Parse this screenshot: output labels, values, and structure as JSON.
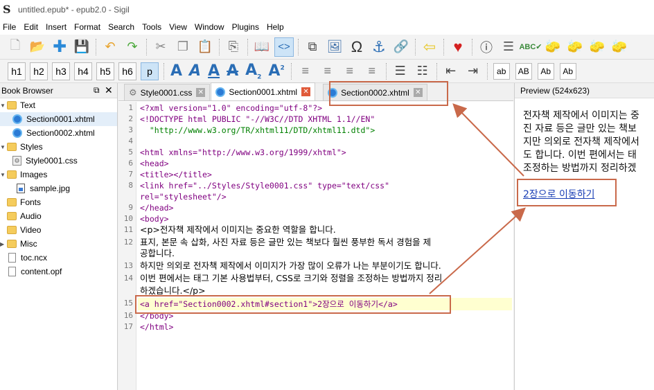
{
  "window": {
    "title": "untitled.epub* - epub2.0 - Sigil"
  },
  "menu": [
    "File",
    "Edit",
    "Insert",
    "Format",
    "Search",
    "Tools",
    "View",
    "Window",
    "Plugins",
    "Help"
  ],
  "toolbar2": {
    "headings": [
      "h1",
      "h2",
      "h3",
      "h4",
      "h5",
      "h6",
      "p"
    ],
    "case_buttons": [
      "ab",
      "AB",
      "Ab",
      "Ab"
    ]
  },
  "book_browser": {
    "title": "Book Browser",
    "items": [
      {
        "label": "Text",
        "type": "folder"
      },
      {
        "label": "Section0001.xhtml",
        "type": "xhtml"
      },
      {
        "label": "Section0002.xhtml",
        "type": "xhtml"
      },
      {
        "label": "Styles",
        "type": "folder"
      },
      {
        "label": "Style0001.css",
        "type": "css"
      },
      {
        "label": "Images",
        "type": "folder"
      },
      {
        "label": "sample.jpg",
        "type": "image"
      },
      {
        "label": "Fonts",
        "type": "folder"
      },
      {
        "label": "Audio",
        "type": "folder"
      },
      {
        "label": "Video",
        "type": "folder"
      },
      {
        "label": "Misc",
        "type": "folder"
      },
      {
        "label": "toc.ncx",
        "type": "file"
      },
      {
        "label": "content.opf",
        "type": "file"
      }
    ]
  },
  "tabs": [
    {
      "label": "Style0001.css"
    },
    {
      "label": "Section0001.xhtml"
    },
    {
      "label": "Section0002.xhtml"
    }
  ],
  "code": {
    "line_numbers": [
      "1",
      "2",
      "3",
      "4",
      "5",
      "6",
      "7",
      "8",
      "9",
      "10",
      "11",
      "12",
      "13",
      "14",
      "15",
      "16",
      "17"
    ],
    "lines": {
      "l1": "<?xml version=\"1.0\" encoding=\"utf-8\"?>",
      "l2": "<!DOCTYPE html PUBLIC \"-//W3C//DTD XHTML 1.1//EN\"",
      "l2b": "  \"http://www.w3.org/TR/xhtml11/DTD/xhtml11.dtd\">",
      "l4": "<html xmlns=\"http://www.w3.org/1999/xhtml\">",
      "l5": "<head>",
      "l6": "<title></title>",
      "l7": "<link href=\"../Styles/Style0001.css\" type=\"text/css\"",
      "l7b": "rel=\"stylesheet\"/>",
      "l8": "</head>",
      "l9": "<body>",
      "l10": "<p>전자책 제작에서 이미지는 중요한 역할을 합니다.",
      "l11": "표지, 본문 속 삽화, 사진 자료 등은 글만 있는 책보다 훨씬 풍부한 독서 경험을 제",
      "l11b": "공합니다.",
      "l12": "하지만 의외로 전자책 제작에서 이미지가 가장 많이 오류가 나는 부분이기도 합니다.",
      "l13": "이번 편에서는 태그 기본 사용법부터, CSS로 크기와 정렬을 조정하는 방법까지 정리",
      "l13b": "하겠습니다.</p>",
      "l15": "<a href=\"Section0002.xhtml#section1\">2장으로 이동하기</a>",
      "l16": "</body>",
      "l17": "</html>"
    }
  },
  "preview": {
    "title": "Preview (524x623)",
    "lines": [
      "전자책 제작에서 이미지는 중",
      "진 자료 등은 글만 있는 책보",
      "지만 의외로 전자책 제작에서",
      "도 합니다. 이번 편에서는 태",
      "조정하는 방법까지 정리하겠"
    ],
    "link_text": "2장으로 이동하기"
  },
  "colors": {
    "annotation": "#c9694a",
    "tag": "#800080",
    "attribute_value": "#008000",
    "highlight_line": "#ffffd0",
    "link": "#1a3fb5"
  }
}
